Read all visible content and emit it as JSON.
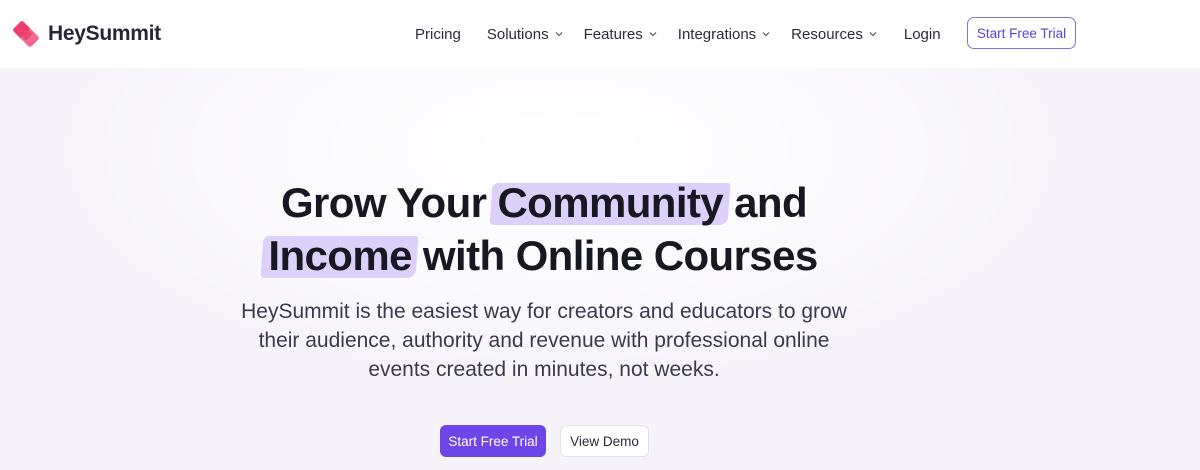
{
  "brand": {
    "name": "HeySummit",
    "logo_icon": "heysummit-logo-icon",
    "accent_color": "#6d45e8",
    "logo_color": "#ec3f6e"
  },
  "nav": {
    "items": [
      {
        "label": "Pricing",
        "has_dropdown": false
      },
      {
        "label": "Solutions",
        "has_dropdown": true
      },
      {
        "label": "Features",
        "has_dropdown": true
      },
      {
        "label": "Integrations",
        "has_dropdown": true
      },
      {
        "label": "Resources",
        "has_dropdown": true
      },
      {
        "label": "Login",
        "has_dropdown": false
      }
    ],
    "cta_label": "Start Free Trial",
    "dropdown_icon": "chevron-down-icon"
  },
  "hero": {
    "headline": {
      "line1_before": "Grow Your ",
      "line1_highlight": "Community",
      "line1_after": " and",
      "line2_highlight": "Income",
      "line2_after": " with Online Courses"
    },
    "subtitle": "HeySummit is the easiest way for creators and educators to grow their audience, authority and revenue with professional online events created in minutes, not weeks.",
    "primary_cta": "Start Free Trial",
    "secondary_cta": "View Demo",
    "highlight_color": "#dcd1fb"
  }
}
